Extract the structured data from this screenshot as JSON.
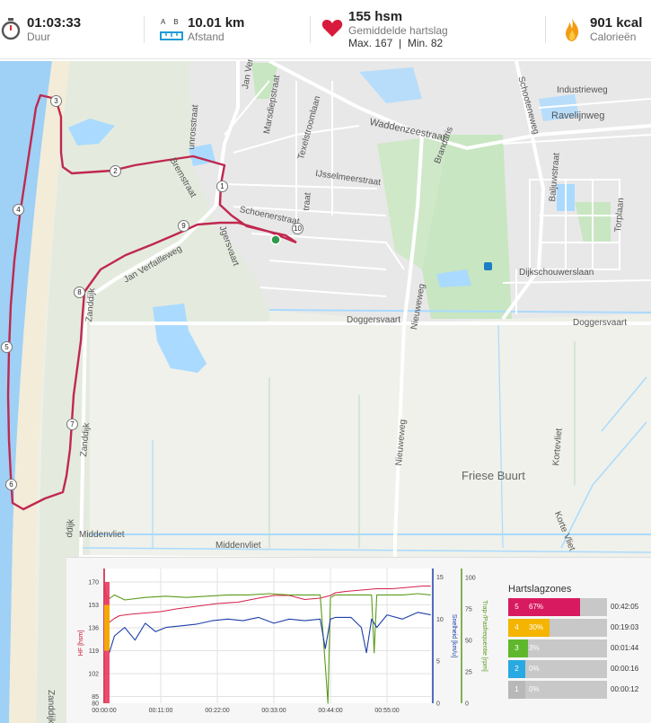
{
  "stats": {
    "duration": {
      "value": "01:03:33",
      "label": "Duur",
      "icon": "stopwatch-icon"
    },
    "distance": {
      "value": "10.01 km",
      "label": "Afstand",
      "ab_a": "A",
      "ab_b": "B",
      "icon": "ruler-icon"
    },
    "heart_rate": {
      "value": "155 hsm",
      "label": "Gemiddelde hartslag",
      "max": "Max. 167",
      "divider": "|",
      "min": "Min. 82",
      "icon": "heart-icon"
    },
    "calories": {
      "value": "901 kcal",
      "label": "Calorieën",
      "icon": "flame-icon"
    }
  },
  "map": {
    "labels": {
      "industrieweg": "Industrieweg",
      "ravelijnweg": "Ravelijnweg",
      "schooteneweg": "Schooteneweg",
      "waddenzeestraat": "Waddenzeestraat",
      "ijsselmeerstraat": "IJsselmeerstraat",
      "schoenerstraat": "Schoenerstraat",
      "texelstroomlaan": "Texelstroomlaan",
      "marsdiepstraat": "Marsdiepstraat",
      "brandaris": "Brandaris",
      "bremstraat": "Bremstraat",
      "jan_ver": "Jan Ver",
      "unrosstraat": "unrosstraat",
      "jan_verfailleweg": "Jan Verfailleweg",
      "jgersvaart": "Jgersvaart",
      "traat": "traat",
      "baljuwstraat": "Baljuwstraat",
      "torplaan": "Torplaan",
      "dijkschouwerslaan": "Dijkschouwerslaan",
      "doggersvaart1": "Doggersvaart",
      "doggersvaart2": "Doggersvaart",
      "nieuweweg1": "Nieuweweg",
      "nieuweweg2": "Nieuweweg",
      "friese_buurt": "Friese Buurt",
      "kortevliet": "Kortevliet",
      "korte_vliet": "Korte Vliet",
      "zanddijk1": "Zanddijk",
      "zanddijk2": "Zanddijk",
      "zanddijk3": "Zanddijk",
      "middenvliet1": "Middenvliet",
      "middenvliet2": "Middenvliet",
      "ddijk": "ddijk"
    },
    "km_markers": [
      "1",
      "2",
      "3",
      "4",
      "5",
      "6",
      "7",
      "8",
      "9",
      "10"
    ],
    "colors": {
      "route": "#c0284f",
      "water": "#aadaff",
      "park": "#c8e6c1",
      "sea": "#9fd0f5"
    }
  },
  "chart_data": {
    "type": "line",
    "x_ticks": [
      "00:00:00",
      "00:11:00",
      "00:22:00",
      "00:33:00",
      "00:44:00",
      "00:55:00"
    ],
    "x_minutes": [
      0,
      11,
      22,
      33,
      44,
      55
    ],
    "x_range_minutes": [
      0,
      63.55
    ],
    "y_left": {
      "label": "HF [hsm]",
      "ticks": [
        "85",
        "102",
        "119",
        "136",
        "153",
        "170"
      ],
      "range": [
        80,
        180
      ]
    },
    "y_right_speed": {
      "label": "Snelheid [km/u]",
      "ticks": [
        "0",
        "5",
        "10",
        "15"
      ],
      "range": [
        0,
        16
      ]
    },
    "y_right_cadence": {
      "label": "Trap-/Pasfrequentie [rpm]",
      "ticks": [
        "0",
        "25",
        "50",
        "75",
        "100"
      ],
      "range": [
        0,
        107
      ]
    },
    "tick_80": "80",
    "series": [
      {
        "key": "hr",
        "color": "#d6214b",
        "axis": "left",
        "x": [
          0,
          1,
          2,
          3,
          5,
          8,
          11,
          14,
          18,
          22,
          26,
          30,
          33,
          36,
          39,
          42,
          44,
          45,
          47,
          50,
          53,
          56,
          59,
          62,
          63.5
        ],
        "y": [
          170,
          140,
          143,
          145,
          146,
          147,
          148,
          150,
          152,
          154,
          155,
          158,
          160,
          160,
          157,
          158,
          160,
          162,
          163,
          164,
          165,
          165,
          166,
          167,
          167
        ]
      },
      {
        "key": "cadence",
        "color": "#5c9a1c",
        "axis": "cadence",
        "x": [
          0,
          1,
          2,
          4,
          8,
          12,
          16,
          20,
          24,
          28,
          32,
          36,
          40,
          42,
          43,
          43.5,
          44,
          45,
          48,
          50,
          52,
          52.5,
          53,
          55,
          58,
          61,
          63.5
        ],
        "y": [
          89,
          83,
          86,
          82,
          84,
          85,
          84,
          85,
          86,
          86,
          87,
          86,
          86,
          86,
          30,
          0,
          84,
          86,
          86,
          86,
          86,
          40,
          86,
          86,
          86,
          87,
          86
        ]
      },
      {
        "key": "speed",
        "color": "#1d3fa8",
        "axis": "speed",
        "x": [
          0,
          1,
          2,
          4,
          6,
          8,
          10,
          12,
          15,
          18,
          21,
          24,
          27,
          30,
          33,
          36,
          39,
          42,
          43,
          44,
          45,
          48,
          50,
          51,
          52,
          53,
          55,
          58,
          61,
          63.5
        ],
        "y": [
          9,
          6,
          8,
          9,
          7.5,
          9.5,
          8.5,
          9,
          9.2,
          9.4,
          9.8,
          10,
          9.8,
          10.2,
          9.5,
          10,
          9.8,
          10,
          6.5,
          10,
          10.2,
          10.2,
          9,
          6,
          10,
          9,
          10.5,
          10,
          10.8,
          10.5
        ]
      }
    ]
  },
  "zones": {
    "title": "Hartslagzones",
    "items": [
      {
        "zone": "5",
        "percent": "67%",
        "fraction": 0.67,
        "time": "00:42:05",
        "color": "#d81b60"
      },
      {
        "zone": "4",
        "percent": "30%",
        "fraction": 0.3,
        "time": "00:19:03",
        "color": "#f4b400"
      },
      {
        "zone": "3",
        "percent": "3%",
        "fraction": 0.03,
        "time": "00:01:44",
        "color": "#5fb82c"
      },
      {
        "zone": "2",
        "percent": "0%",
        "fraction": 0.0,
        "time": "00:00:16",
        "color": "#29a9e1"
      },
      {
        "zone": "1",
        "percent": "0%",
        "fraction": 0.0,
        "time": "00:00:12",
        "color": "#b8b8b8"
      }
    ]
  }
}
